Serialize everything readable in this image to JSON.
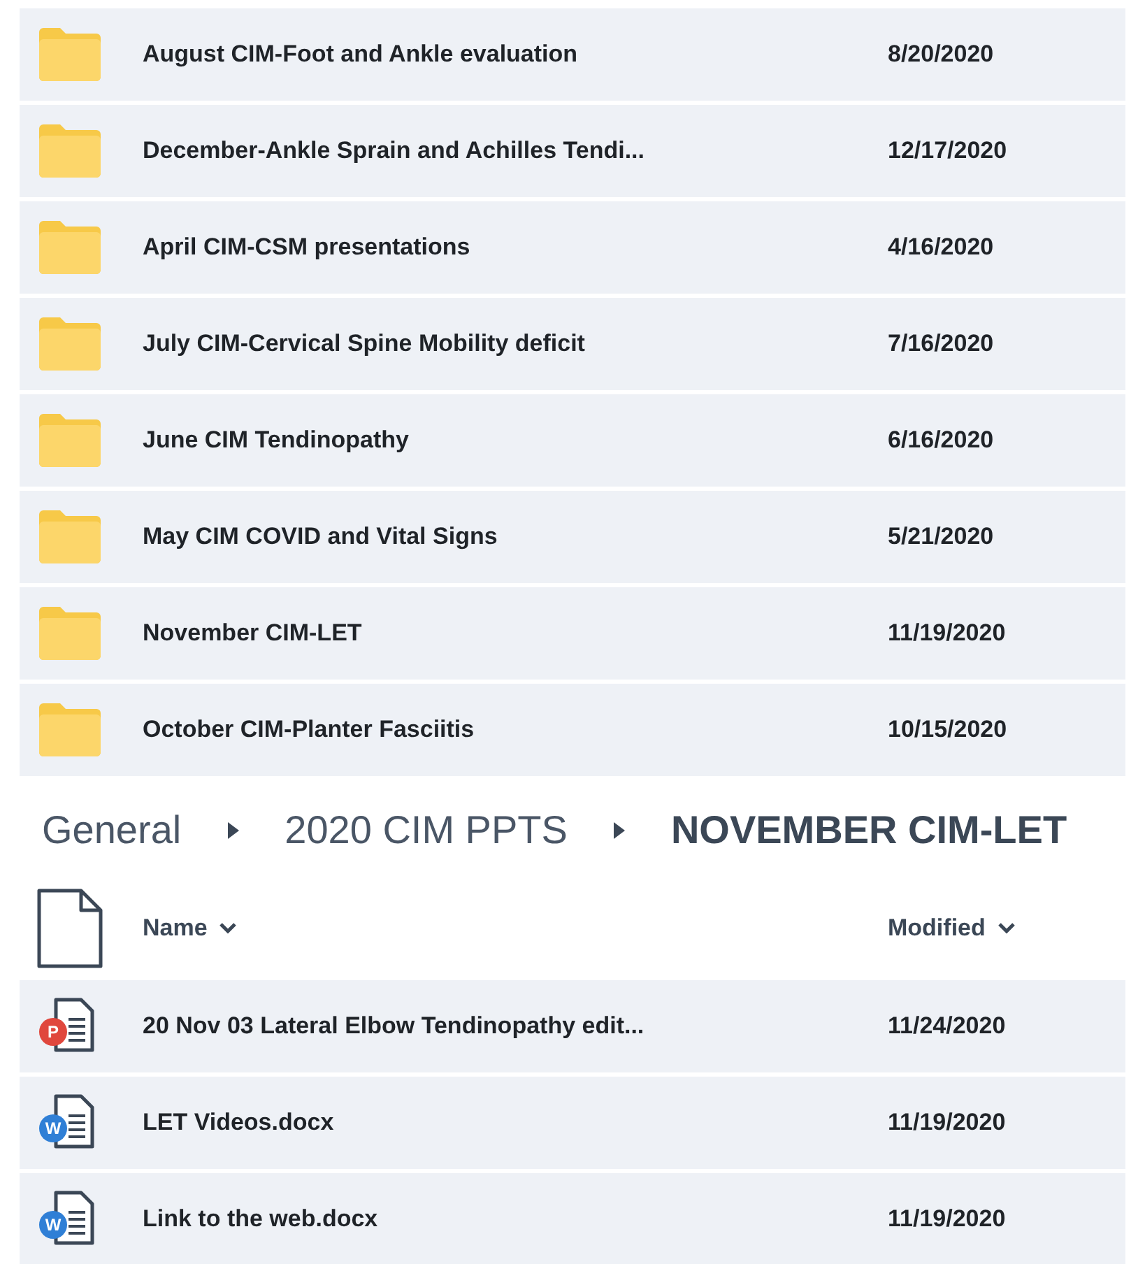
{
  "folders": [
    {
      "name": "August CIM-Foot and Ankle evaluation",
      "modified": "8/20/2020"
    },
    {
      "name": "December-Ankle Sprain and Achilles Tendi...",
      "modified": "12/17/2020"
    },
    {
      "name": "April CIM-CSM presentations",
      "modified": "4/16/2020"
    },
    {
      "name": "July CIM-Cervical Spine Mobility deficit",
      "modified": "7/16/2020"
    },
    {
      "name": "June CIM Tendinopathy",
      "modified": "6/16/2020"
    },
    {
      "name": "May CIM COVID and Vital Signs",
      "modified": "5/21/2020"
    },
    {
      "name": "November CIM-LET",
      "modified": "11/19/2020"
    },
    {
      "name": "October CIM-Planter Fasciitis",
      "modified": "10/15/2020"
    }
  ],
  "breadcrumb": [
    {
      "label": "General",
      "current": false
    },
    {
      "label": "2020 CIM PPTS",
      "current": false
    },
    {
      "label": "NOVEMBER CIM-LET",
      "current": true
    }
  ],
  "columns": {
    "name": "Name",
    "modified": "Modified"
  },
  "files": [
    {
      "kind": "powerpoint",
      "badge": "P",
      "name": "20 Nov 03 Lateral Elbow Tendinopathy edit...",
      "modified": "11/24/2020"
    },
    {
      "kind": "word",
      "badge": "W",
      "name": "LET Videos.docx",
      "modified": "11/19/2020"
    },
    {
      "kind": "word",
      "badge": "W",
      "name": "Link to the web.docx",
      "modified": "11/19/2020"
    }
  ]
}
